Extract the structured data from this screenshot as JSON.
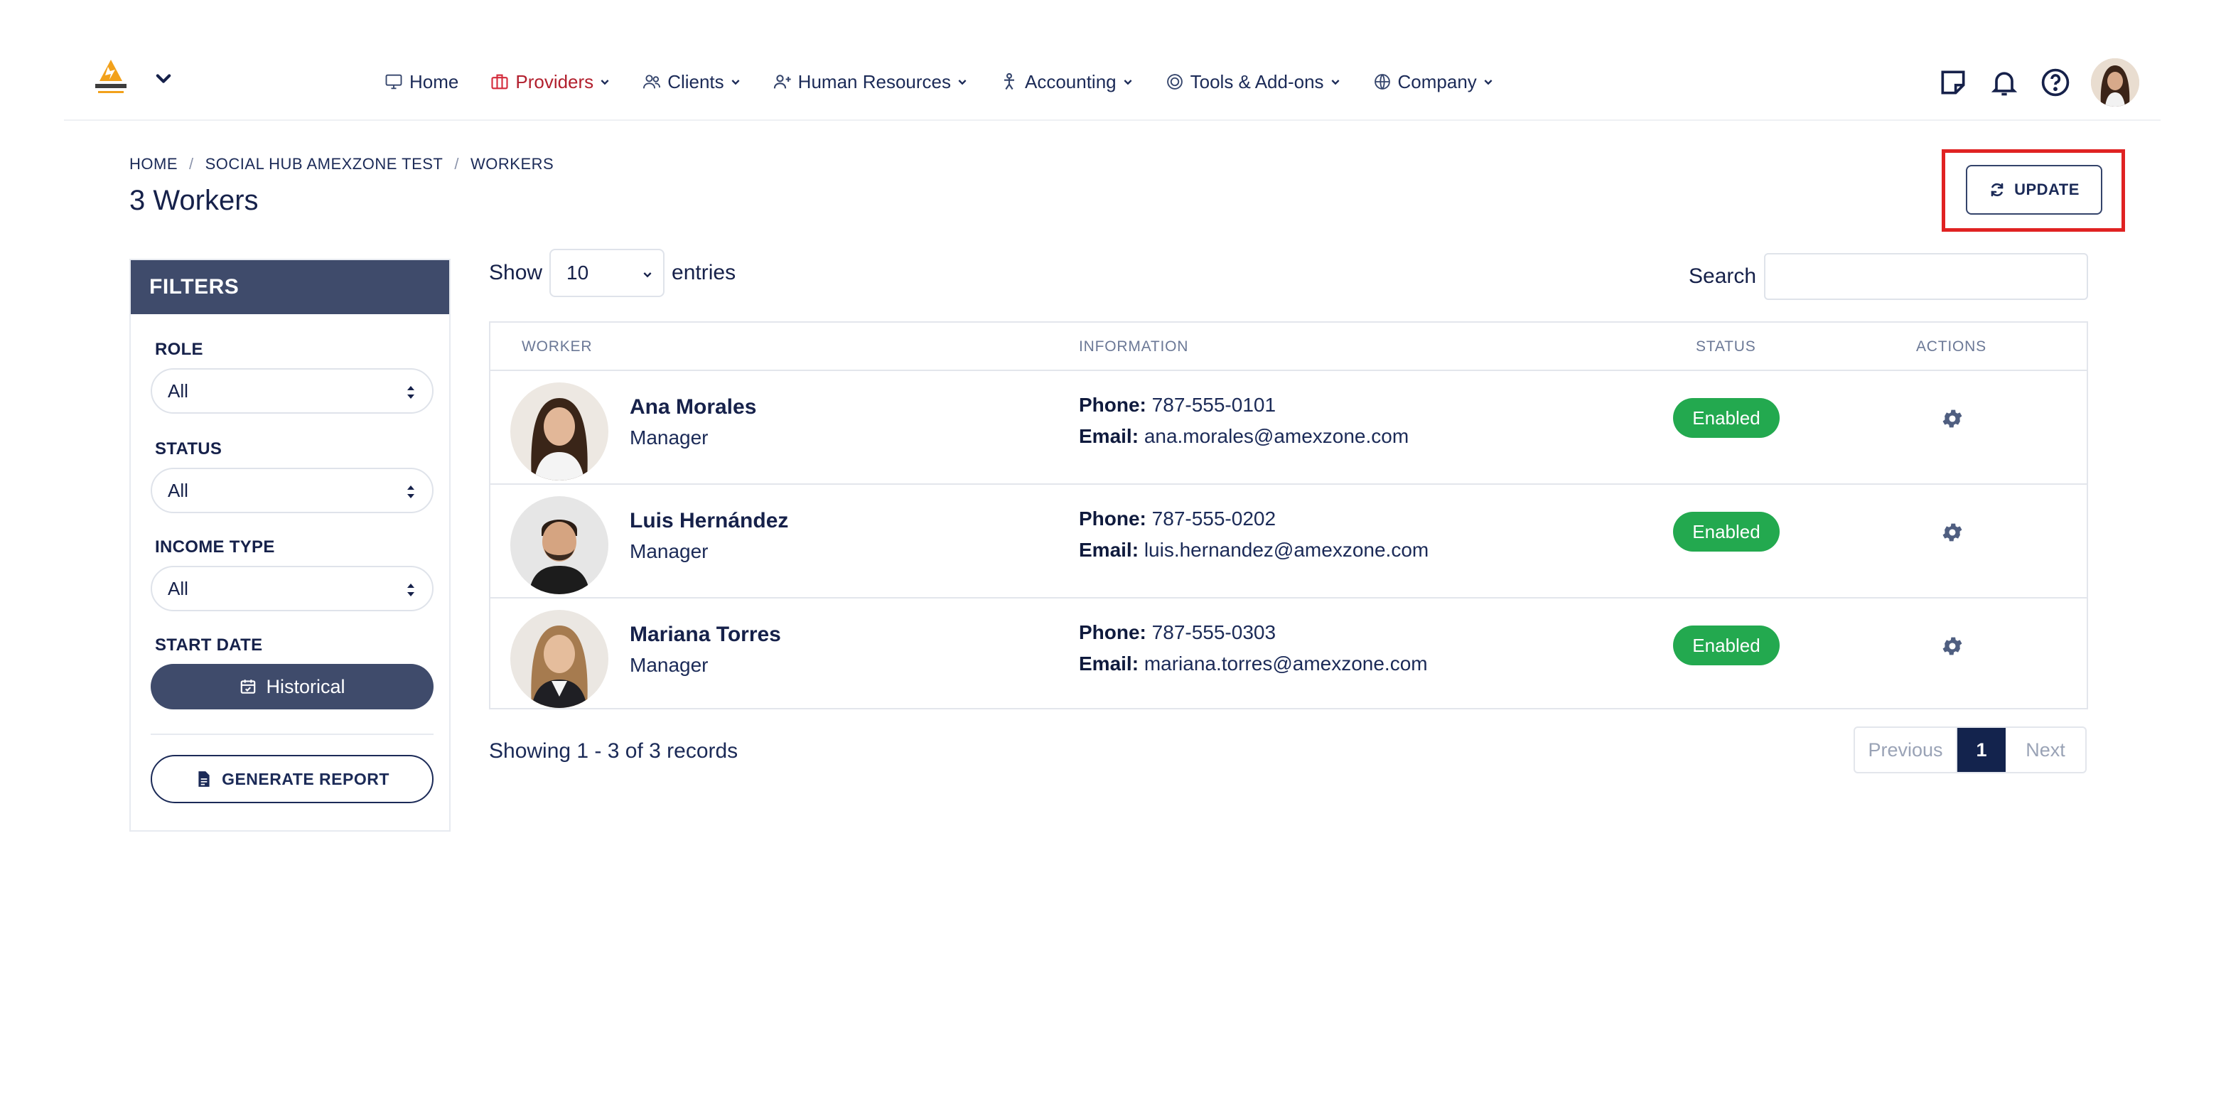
{
  "nav": {
    "items": [
      {
        "label": "Home",
        "icon": "monitor-icon"
      },
      {
        "label": "Providers",
        "icon": "briefcase-icon"
      },
      {
        "label": "Clients",
        "icon": "users-icon"
      },
      {
        "label": "Human Resources",
        "icon": "user-plus-icon"
      },
      {
        "label": "Accounting",
        "icon": "person-icon"
      },
      {
        "label": "Tools & Add-ons",
        "icon": "target-icon"
      },
      {
        "label": "Company",
        "icon": "globe-icon"
      }
    ]
  },
  "breadcrumb": [
    "HOME",
    "SOCIAL HUB AMEXZONE TEST",
    "WORKERS"
  ],
  "page_title": "3 Workers",
  "update_label": "UPDATE",
  "filters": {
    "title": "FILTERS",
    "role_label": "ROLE",
    "role_value": "All",
    "status_label": "STATUS",
    "status_value": "All",
    "income_label": "INCOME TYPE",
    "income_value": "All",
    "start_label": "START DATE",
    "historical_label": "Historical",
    "report_label": "GENERATE REPORT"
  },
  "table": {
    "show_label": "Show",
    "entries_value": "10",
    "entries_label": "entries",
    "search_label": "Search",
    "search_value": "",
    "headers": {
      "worker": "WORKER",
      "information": "INFORMATION",
      "status": "STATUS",
      "actions": "ACTIONS"
    },
    "phone_label": "Phone:",
    "email_label": "Email:",
    "rows": [
      {
        "name": "Ana Morales",
        "role": "Manager",
        "phone": "787-555-0101",
        "email": "ana.morales@amexzone.com",
        "status": "Enabled"
      },
      {
        "name": "Luis Hernández",
        "role": "Manager",
        "phone": "787-555-0202",
        "email": "luis.hernandez@amexzone.com",
        "status": "Enabled"
      },
      {
        "name": "Mariana Torres",
        "role": "Manager",
        "phone": "787-555-0303",
        "email": "mariana.torres@amexzone.com",
        "status": "Enabled"
      }
    ],
    "showing": "Showing 1 - 3 of 3 records",
    "pagination": {
      "previous": "Previous",
      "current": "1",
      "next": "Next"
    }
  },
  "colors": {
    "primary": "#13234d",
    "filters_header": "#3f4b6b",
    "enabled": "#23a94f",
    "highlight": "#e02222",
    "providers": "#b2202e"
  }
}
